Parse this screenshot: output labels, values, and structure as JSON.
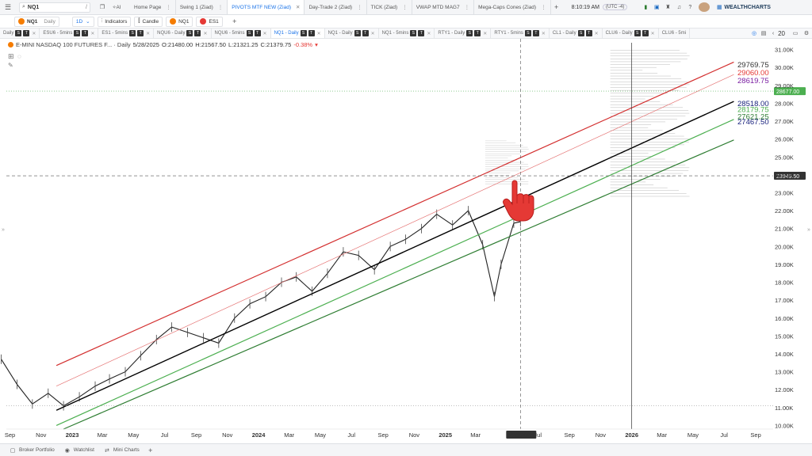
{
  "topbar": {
    "search_value": "NQ1",
    "tabs": [
      "Home Page",
      "Swing 1 (Ziad)",
      "PIVOTS MTF NEW (Ziad)",
      "Day-Trade 2 (Ziad)",
      "TICK (Ziad)",
      "VWAP MTD MAG7",
      "Mega-Caps Cones (Ziad)"
    ],
    "active_tab": 2,
    "clock": "8:10:19 AM",
    "timezone": "(UTC -4)",
    "brand": "WEALTHCHARTS"
  },
  "symbar": {
    "symbol": "NQ1",
    "timeframe": "Daily",
    "interval": "1D",
    "indicators_label": "Indicators",
    "candle_label": "Candle",
    "compare1": "NQ1",
    "compare2": "ES1"
  },
  "chart_tabs": [
    {
      "label": "Daily",
      "badges": true
    },
    {
      "label": "ESU6 - 5mins",
      "badges": true
    },
    {
      "label": "ES1 - 5mins",
      "badges": true
    },
    {
      "label": "NQU6 - Daily",
      "badges": true
    },
    {
      "label": "NQU6 - 5mins",
      "badges": true
    },
    {
      "label": "NQ1 - Daily",
      "badges": true
    },
    {
      "label": "NQ1 - Daily",
      "badges": true
    },
    {
      "label": "NQ1 - 5mins",
      "badges": true
    },
    {
      "label": "RTY1 - Daily",
      "badges": true
    },
    {
      "label": "RTY1 - 5mins",
      "badges": true
    },
    {
      "label": "CL1 - Daily",
      "badges": true
    },
    {
      "label": "CLU6 - Daily",
      "badges": true
    },
    {
      "label": "CLU6 - 5mi",
      "badges": false
    }
  ],
  "chart_tabs_active": 5,
  "chart_tabs_count": "20",
  "legend": {
    "title": "E-MINI NASDAQ 100 FUTURES F... · Daily",
    "date": "5/28/2025",
    "open": "O:21480.00",
    "high": "H:21567.50",
    "low": "L:21321.25",
    "close": "C:21379.75",
    "change": "-0.38%"
  },
  "bottombar": {
    "items": [
      "Broker Portfolio",
      "Watchlist",
      "Mini Charts"
    ]
  },
  "colors": {
    "up": "#1a1a1a",
    "down": "#1a1a1a",
    "channel_red": "#d32f2f",
    "channel_black": "#000000",
    "channel_green": "#2e7d32",
    "channel_light_green": "#4caf50",
    "accent": "#1a73e8"
  },
  "chart_data": {
    "type": "line",
    "title": "E-MINI NASDAQ 100 FUTURES F... · Daily",
    "x": [
      "2022-08-15",
      "2022-09-15",
      "2022-10-15",
      "2022-11-15",
      "2022-12-15",
      "2023-01-15",
      "2023-02-15",
      "2023-03-15",
      "2023-04-15",
      "2023-05-15",
      "2023-06-15",
      "2023-07-15",
      "2023-08-15",
      "2023-09-15",
      "2023-10-15",
      "2023-11-15",
      "2023-12-15",
      "2024-01-15",
      "2024-02-15",
      "2024-03-15",
      "2024-04-15",
      "2024-05-15",
      "2024-06-15",
      "2024-07-15",
      "2024-08-15",
      "2024-09-15",
      "2024-10-15",
      "2024-11-15",
      "2024-12-15",
      "2025-01-15",
      "2025-02-15",
      "2025-03-15",
      "2025-04-07",
      "2025-04-20",
      "2025-05-15",
      "2025-05-28"
    ],
    "series": [
      {
        "values": [
          13700,
          12300,
          11200,
          11800,
          11100,
          11600,
          12200,
          12600,
          13000,
          13900,
          14800,
          15500,
          15200,
          14900,
          14600,
          16000,
          16800,
          17200,
          18000,
          18300,
          17500,
          18500,
          19700,
          19500,
          18700,
          20000,
          20400,
          21000,
          21800,
          21200,
          22000,
          20100,
          17200,
          19000,
          21300,
          21380
        ]
      }
    ],
    "ylim": [
      9800,
      31600
    ],
    "xlim": [
      "2022-08-25",
      "2026-10-05"
    ],
    "y_ticks": [
      "10.00K",
      "11.00K",
      "12.00K",
      "13.00K",
      "14.00K",
      "15.00K",
      "16.00K",
      "17.00K",
      "18.00K",
      "19.00K",
      "20.00K",
      "21.00K",
      "22.00K",
      "23.00K",
      "24.00K",
      "25.00K",
      "26.00K",
      "27.00K",
      "28.00K",
      "29.00K",
      "30.00K",
      "31.00K"
    ],
    "y_tick_values": [
      10000,
      11000,
      12000,
      13000,
      14000,
      15000,
      16000,
      17000,
      18000,
      19000,
      20000,
      21000,
      22000,
      23000,
      24000,
      25000,
      26000,
      27000,
      28000,
      29000,
      30000,
      31000
    ],
    "x_ticks": [
      "Sep",
      "Nov",
      "2023",
      "Mar",
      "May",
      "Jul",
      "Sep",
      "Nov",
      "2024",
      "Mar",
      "May",
      "Jul",
      "Sep",
      "Nov",
      "2025",
      "Mar",
      "5/28/2025",
      "Jul",
      "Sep",
      "Nov",
      "2026",
      "Mar",
      "May",
      "Jul",
      "Sep"
    ],
    "x_tick_dates": [
      "2022-09-01",
      "2022-11-01",
      "2023-01-01",
      "2023-03-01",
      "2023-05-01",
      "2023-07-01",
      "2023-09-01",
      "2023-11-01",
      "2024-01-01",
      "2024-03-01",
      "2024-05-01",
      "2024-07-01",
      "2024-09-01",
      "2024-11-01",
      "2025-01-01",
      "2025-03-01",
      "2025-05-28",
      "2025-07-01",
      "2025-09-01",
      "2025-11-01",
      "2026-01-01",
      "2026-03-01",
      "2026-05-01",
      "2026-07-01",
      "2026-09-01"
    ],
    "bold_x_ticks": [
      "2023",
      "2024",
      "2025",
      "2026"
    ],
    "channels": [
      {
        "color": "#d32f2f",
        "width": 1.2,
        "from": [
          "2022-12-01",
          13350
        ],
        "to": [
          "2026-07-20",
          30300
        ]
      },
      {
        "color": "#e57373",
        "width": 0.7,
        "from": [
          "2022-12-01",
          12200
        ],
        "to": [
          "2026-07-20",
          29600
        ]
      },
      {
        "color": "#000000",
        "width": 1.4,
        "from": [
          "2022-12-01",
          10850
        ],
        "to": [
          "2026-07-20",
          28100
        ]
      },
      {
        "color": "#4caf50",
        "width": 1.2,
        "from": [
          "2022-12-01",
          10000
        ],
        "to": [
          "2026-07-20",
          27100
        ]
      },
      {
        "color": "#2e7d32",
        "width": 1.2,
        "from": [
          "2022-12-15",
          9800
        ],
        "to": [
          "2026-07-20",
          25950
        ]
      }
    ],
    "levels": [
      {
        "label": "29769.75",
        "value": 30150,
        "color": "#333333"
      },
      {
        "label": "29060.00",
        "value": 29690,
        "color": "#e53935"
      },
      {
        "label": "28619.75",
        "value": 29260,
        "color": "#7b1fa2"
      },
      {
        "label": "28518.00",
        "value": 27980,
        "color": "#1a237e"
      },
      {
        "label": "28179.75",
        "value": 27640,
        "color": "#4caf50"
      },
      {
        "label": "27621.25",
        "value": 27240,
        "color": "#2e7d32"
      },
      {
        "label": "27467.50",
        "value": 26960,
        "color": "#1a237e"
      }
    ],
    "crosshair": {
      "x": "2025-05-28",
      "y": 23949.5,
      "label": "23949.50"
    },
    "current_price": {
      "value": 28677.0,
      "label": "28677.00"
    },
    "dotted_levels": [
      28677.0,
      11100
    ],
    "vertical_line": "2026-01-01",
    "annotation": "pointing-hand-icon"
  }
}
